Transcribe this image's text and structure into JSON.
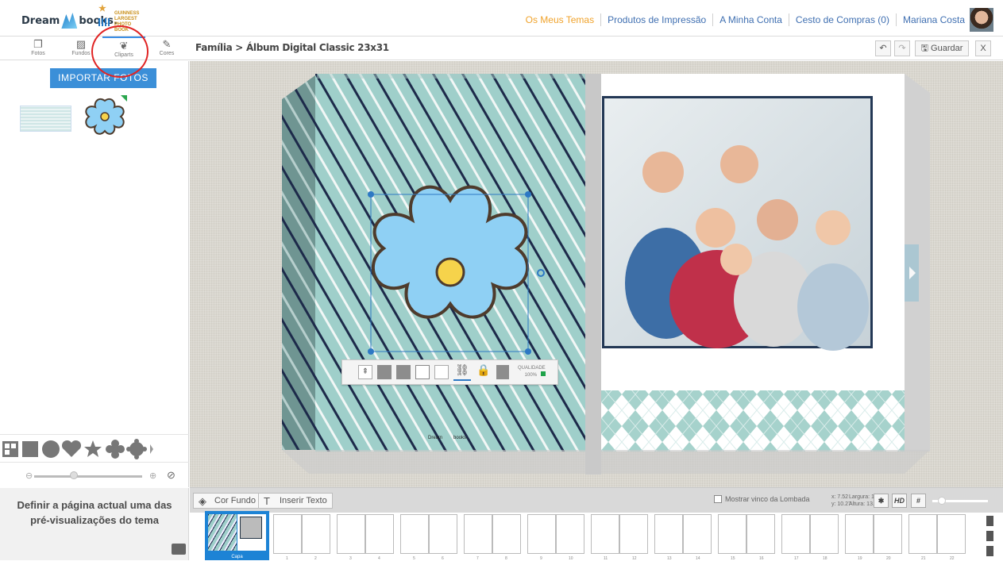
{
  "header": {
    "logo_text_left": "Dream",
    "logo_text_right": "books.",
    "badge_lines": [
      "GUINNESS",
      "LARGEST",
      "PHOTO BOOK"
    ],
    "nav": [
      "Os Meus Temas",
      "Produtos de Impressão",
      "A Minha Conta",
      "Cesto de Compras (0)",
      "Mariana Costa"
    ],
    "active_color": "#f0a32c",
    "link_color": "#3f6fb1"
  },
  "toolbar": {
    "tabs": [
      "Fotos",
      "Fundos",
      "Cliparts",
      "Cores"
    ],
    "breadcrumb": "Família > Álbum Digital Classic 23x31",
    "save_label": "Guardar",
    "close_label": "X"
  },
  "sidebar": {
    "import_button": "IMPORTAR FOTOS",
    "footer_text": "Definir a página actual uma das pré-visualizações do tema",
    "accent": "#3b8fd8"
  },
  "editor": {
    "selection_toolbar": {
      "quality_label": "QUALIDADE",
      "quality_value": "100%"
    },
    "watermark_left": "Dream",
    "watermark_right": "books."
  },
  "bottom_bar": {
    "bg_button": "Cor Fundo",
    "text_button": "Inserir Texto",
    "spine_label": "Mostrar vinco da Lombada",
    "x_label": "x: 7.52",
    "y_label": "y: 10.27",
    "width_label": "Largura: 13.46",
    "height_label": "Altura: 13.46",
    "hd_label": "HD"
  },
  "filmstrip": {
    "cover_label": "Capa",
    "page_numbers": [
      "1",
      "2",
      "3",
      "4",
      "5",
      "6",
      "7",
      "8",
      "9",
      "10",
      "11",
      "12",
      "13",
      "14",
      "15",
      "16",
      "17",
      "18",
      "19",
      "20",
      "21",
      "22"
    ]
  },
  "icons": [
    "fotos-icon",
    "fundos-icon",
    "cliparts-icon",
    "cores-icon",
    "undo-icon",
    "redo-icon",
    "save-icon",
    "bucket-icon",
    "text-icon",
    "qr-icon",
    "square-icon",
    "circle-icon",
    "heart-icon",
    "star-icon",
    "flower-icon",
    "badge-icon",
    "eye-off-icon",
    "camera-icon",
    "bug-icon",
    "grid-icon",
    "add-page-icon",
    "copy-page-icon",
    "trash-icon"
  ]
}
